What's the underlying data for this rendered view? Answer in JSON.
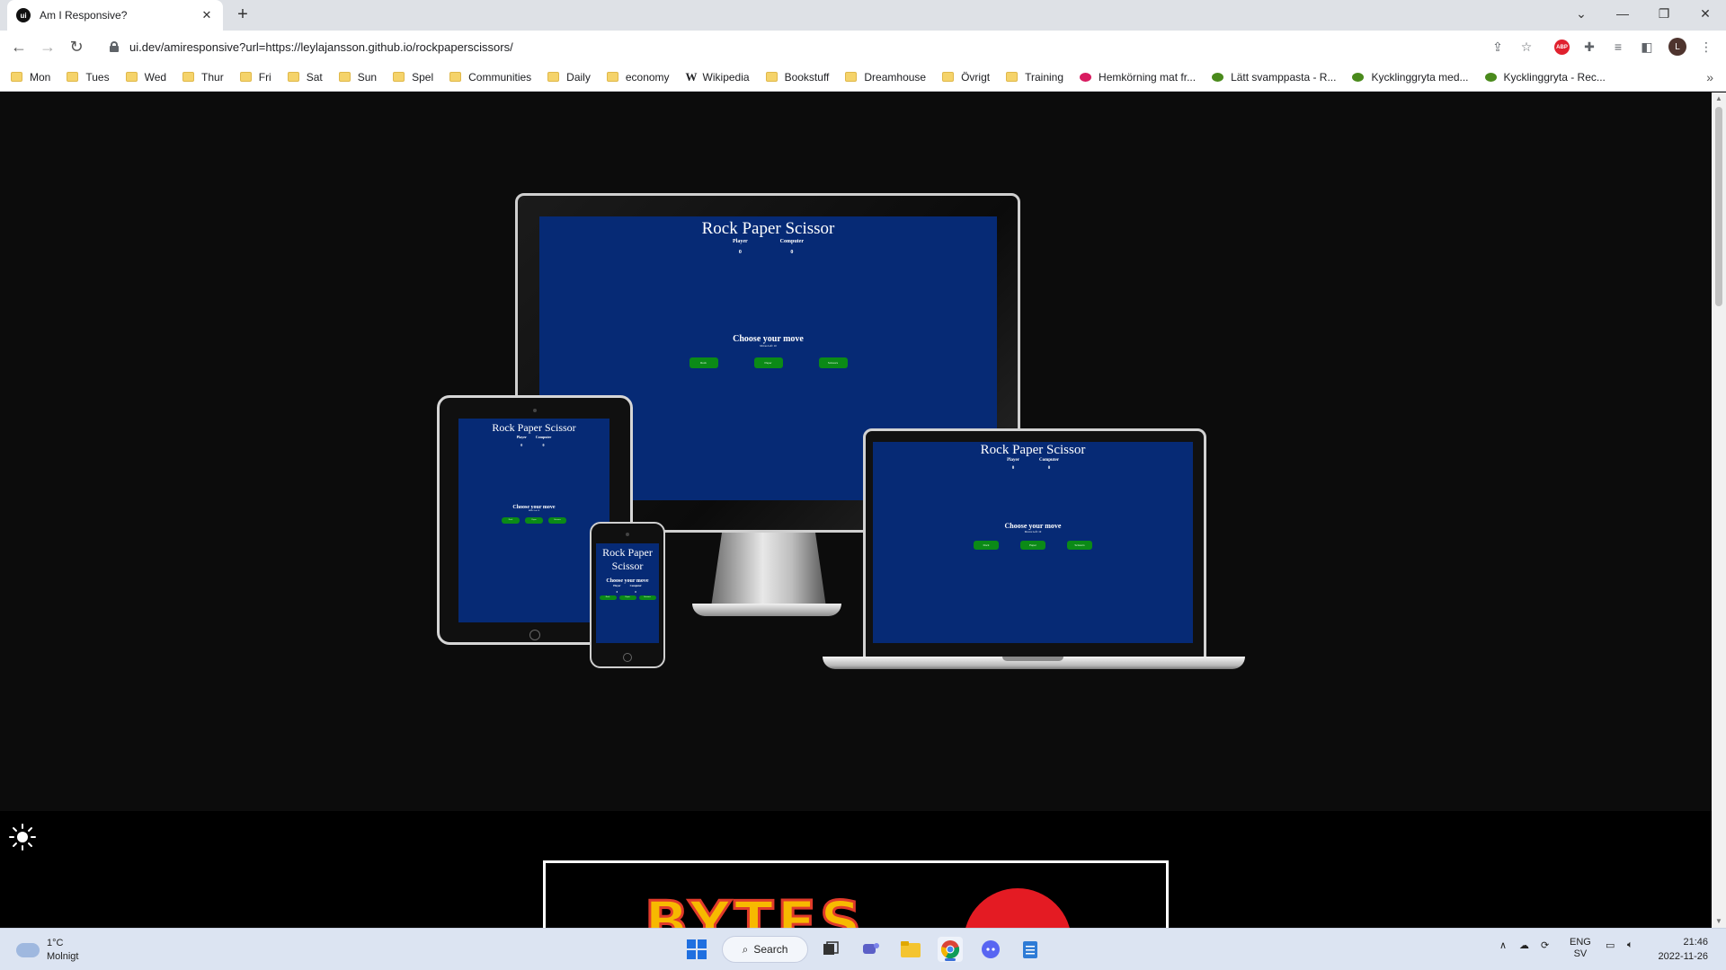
{
  "browser": {
    "tab_title": "Am I Responsive?",
    "tab_favicon": "ui",
    "url": "ui.dev/amiresponsive?url=https://leylajansson.github.io/rockpaperscissors/",
    "profile_initial": "L",
    "abp_label": "ABP"
  },
  "bookmarks": [
    {
      "label": "Mon",
      "icon": "folder-icon"
    },
    {
      "label": "Tues",
      "icon": "folder-icon"
    },
    {
      "label": "Wed",
      "icon": "folder-icon"
    },
    {
      "label": "Thur",
      "icon": "folder-icon"
    },
    {
      "label": "Fri",
      "icon": "folder-icon"
    },
    {
      "label": "Sat",
      "icon": "folder-icon"
    },
    {
      "label": "Sun",
      "icon": "folder-icon"
    },
    {
      "label": "Spel",
      "icon": "folder-icon"
    },
    {
      "label": "Communities",
      "icon": "folder-icon"
    },
    {
      "label": "Daily",
      "icon": "folder-icon"
    },
    {
      "label": "economy",
      "icon": "folder-icon"
    },
    {
      "label": "Wikipedia",
      "icon": "wikipedia-icon"
    },
    {
      "label": "Bookstuff",
      "icon": "folder-icon"
    },
    {
      "label": "Dreamhouse",
      "icon": "folder-icon"
    },
    {
      "label": "Övrigt",
      "icon": "folder-icon"
    },
    {
      "label": "Training",
      "icon": "folder-icon"
    },
    {
      "label": "Hemkörning mat fr...",
      "icon": "site-icon"
    },
    {
      "label": "Lätt svamppasta - R...",
      "icon": "site-icon"
    },
    {
      "label": "Kycklinggryta med...",
      "icon": "site-icon"
    },
    {
      "label": "Kycklinggryta - Rec...",
      "icon": "site-icon"
    }
  ],
  "game": {
    "title": "Rock Paper Scissor",
    "player_label": "Player",
    "computer_label": "Computer",
    "player_score": "0",
    "computer_score": "0",
    "choose_label": "Choose your move",
    "moves_left": "Moves Left: 10",
    "moves": [
      "Rock",
      "Paper",
      "Scissors"
    ]
  },
  "page_lower": {
    "banner_text": "BYTES"
  },
  "taskbar": {
    "temperature": "1°C",
    "weather": "Molnigt",
    "search_label": "Search",
    "lang_top": "ENG",
    "lang_bottom": "SV",
    "time": "21:46",
    "date": "2022-11-26"
  },
  "colors": {
    "game_background": "#062a75",
    "move_button": "#0b8a17",
    "page_background": "#0c0c0c"
  }
}
